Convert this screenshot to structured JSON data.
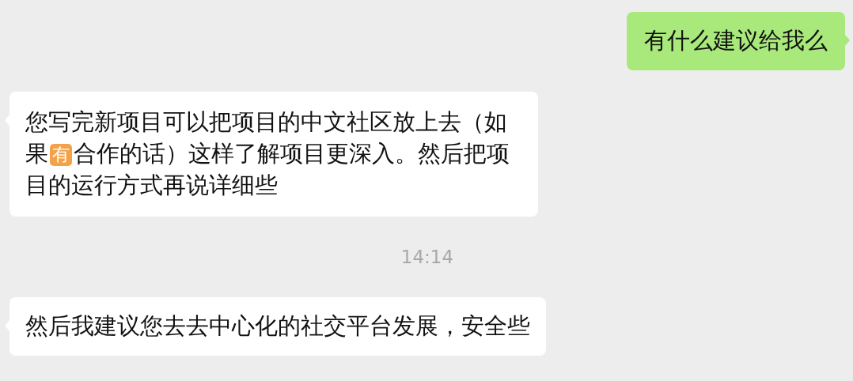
{
  "messages": [
    {
      "kind": "outgoing",
      "segments": [
        {
          "kind": "text",
          "text": "有什么建议给我么"
        }
      ]
    },
    {
      "kind": "incoming",
      "segments": [
        {
          "kind": "text",
          "text": "您写完新项目可以把项目的中文社区放上去（如果"
        },
        {
          "kind": "emoji",
          "text": "有"
        },
        {
          "kind": "text",
          "text": "合作的话）这样了解项目更深入。然后把项目的运行方式再说详细些"
        }
      ]
    },
    {
      "kind": "time",
      "text": "14:14"
    },
    {
      "kind": "incoming",
      "segments": [
        {
          "kind": "text",
          "text": "然后我建议您去去中心化的社交平台发展，安全些"
        }
      ]
    }
  ]
}
